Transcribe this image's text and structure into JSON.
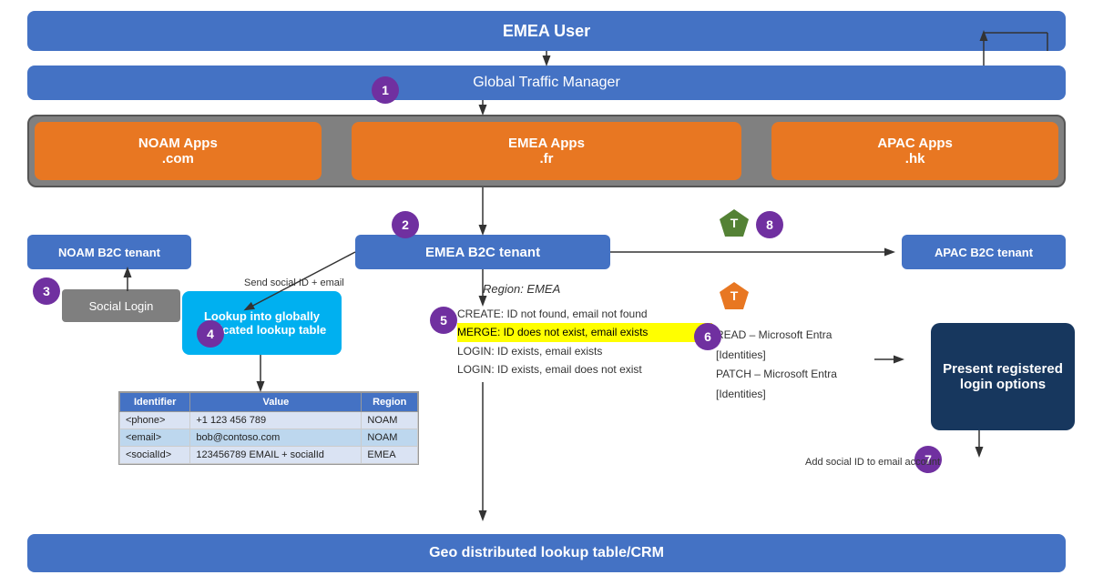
{
  "bars": {
    "emeaUser": "EMEA User",
    "gtm": "Global Traffic Manager",
    "geo": "Geo distributed lookup table/CRM"
  },
  "apps": {
    "noam": "NOAM Apps\n.com",
    "emea": "EMEA Apps\n.fr",
    "apac": "APAC Apps\n.hk"
  },
  "tenants": {
    "noam": "NOAM B2C tenant",
    "emea": "EMEA B2C tenant",
    "apac": "APAC B2C tenant"
  },
  "boxes": {
    "socialLogin": "Social Login",
    "lookup": "Lookup into globally replicated lookup table",
    "presentLogin": "Present registered login options"
  },
  "labels": {
    "region": "Region: EMEA",
    "sendSocialId": "Send social ID + email",
    "addSocialId": "Add social ID to email account"
  },
  "step5": {
    "line1": "CREATE: ID not found, email not found",
    "line2": "MERGE: ID does not exist, email exists",
    "line3": "LOGIN: ID exists, email exists",
    "line4": "LOGIN: ID exists, email does not exist"
  },
  "step6": {
    "line1": "READ – Microsoft Entra [Identities]",
    "line2": "PATCH – Microsoft Entra [Identities]"
  },
  "badges": {
    "b1": "1",
    "b2": "2",
    "b3": "3",
    "b4": "4",
    "b5": "5",
    "b6": "6",
    "b7": "7",
    "b8": "8"
  },
  "table": {
    "rows": [
      {
        "identifier": "<phone>",
        "value": "+1 123 456 789",
        "region": "NOAM"
      },
      {
        "identifier": "<email>",
        "value": "bob@contoso.com",
        "region": "NOAM"
      },
      {
        "identifier": "<socialId>",
        "value": "123456789 EMAIL + socialId",
        "region": "EMEA"
      }
    ]
  }
}
